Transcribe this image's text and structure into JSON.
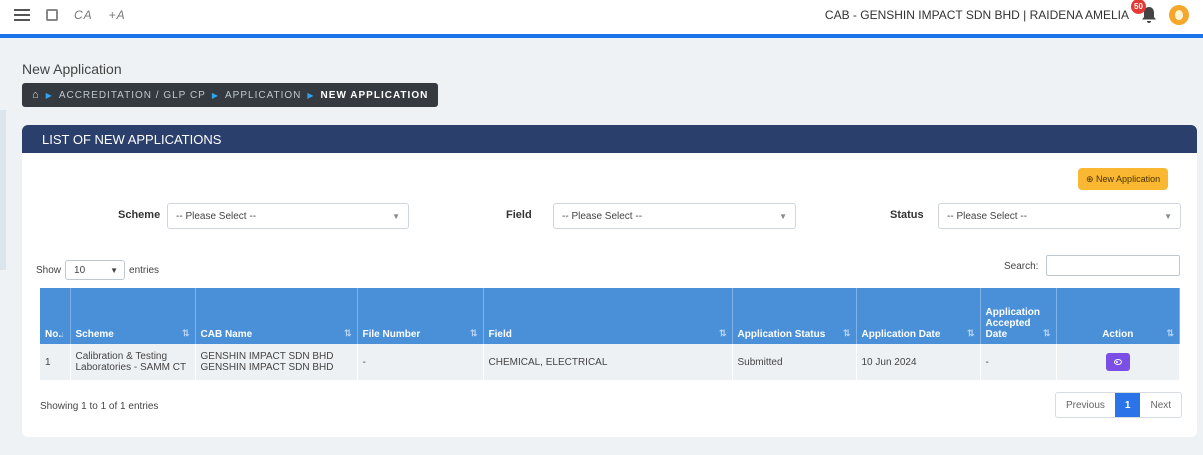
{
  "topbar": {
    "font_decrease": "CA",
    "font_increase": "+A",
    "cab_info": "CAB - GENSHIN IMPACT SDN BHD | RAIDENA AMELIA",
    "notification_count": "50"
  },
  "page": {
    "title": "New Application",
    "breadcrumb": [
      "ACCREDITATION / GLP CP",
      "APPLICATION",
      "NEW APPLICATION"
    ]
  },
  "card": {
    "title": "LIST OF NEW APPLICATIONS",
    "new_button": "⊕ New Application"
  },
  "filters": {
    "scheme_label": "Scheme",
    "scheme_value": "-- Please Select --",
    "field_label": "Field",
    "field_value": "-- Please Select --",
    "status_label": "Status",
    "status_value": "-- Please Select --"
  },
  "table_controls": {
    "show": "Show",
    "entries_value": "10",
    "entries": "entries",
    "search": "Search:"
  },
  "table": {
    "headers": {
      "no": "No.",
      "scheme": "Scheme",
      "cab_name": "CAB Name",
      "file_number": "File Number",
      "field": "Field",
      "status": "Application Status",
      "date": "Application Date",
      "accepted": "Application Accepted Date",
      "action": "Action"
    },
    "rows": [
      {
        "no": "1",
        "scheme": "Calibration & Testing Laboratories - SAMM CT",
        "cab_name": "GENSHIN IMPACT SDN BHD GENSHIN IMPACT SDN BHD",
        "file_number": "-",
        "field": "CHEMICAL, ELECTRICAL",
        "status": "Submitted",
        "date": "10 Jun 2024",
        "accepted": "-"
      }
    ]
  },
  "footer": {
    "info": "Showing 1 to 1 of 1 entries",
    "previous": "Previous",
    "page": "1",
    "next": "Next"
  }
}
